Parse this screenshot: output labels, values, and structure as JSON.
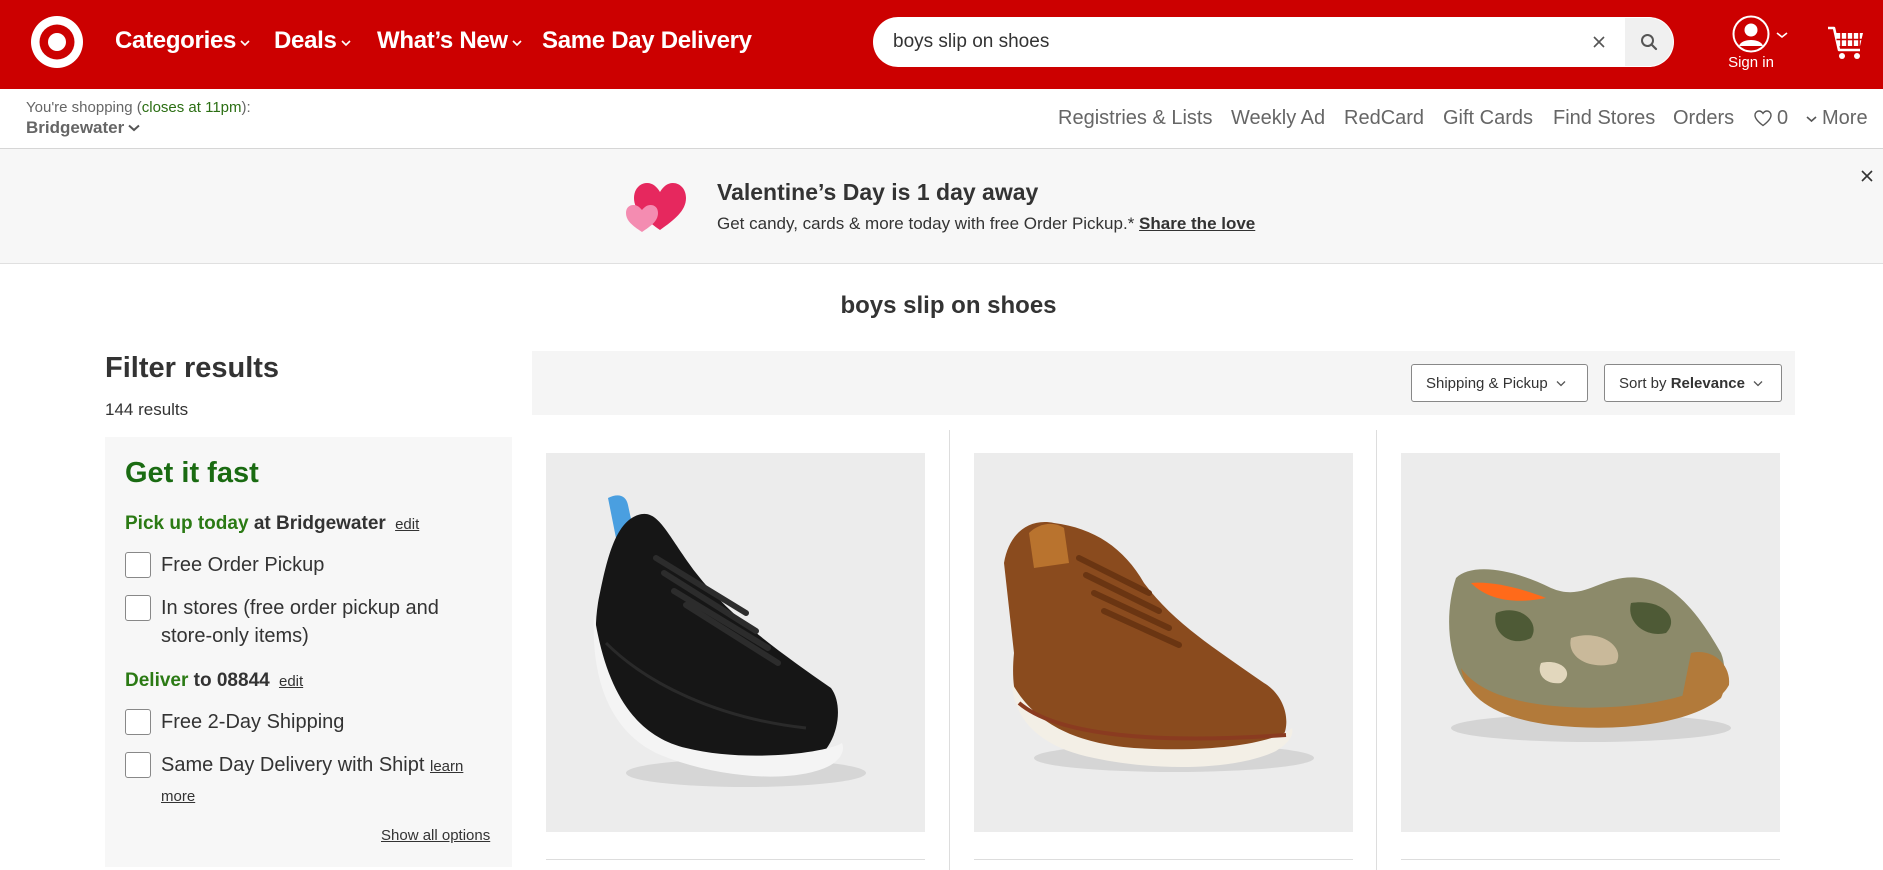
{
  "header": {
    "nav": [
      {
        "label": "Categories",
        "has_menu": true
      },
      {
        "label": "Deals",
        "has_menu": true
      },
      {
        "label": "What’s New",
        "has_menu": true
      },
      {
        "label": "Same Day Delivery",
        "has_menu": false
      }
    ],
    "search": {
      "value": "boys slip on shoes"
    },
    "account_label": "Sign in",
    "colors": {
      "brand_red": "#cc0000",
      "pickup_green": "#2b7a14"
    }
  },
  "store": {
    "line1_prefix": "You're shopping (",
    "closes": "closes at 11pm",
    "line1_suffix": "):",
    "name": "Bridgewater"
  },
  "utility_links": {
    "registries": "Registries & Lists",
    "weekly_ad": "Weekly Ad",
    "redcard": "RedCard",
    "gift_cards": "Gift Cards",
    "find_stores": "Find Stores",
    "orders": "Orders",
    "favorites_count": "0",
    "more": "More"
  },
  "banner": {
    "title": "Valentine’s Day is 1 day away",
    "subtitle": "Get candy, cards & more today with free Order Pickup.*",
    "cta": "Share the love"
  },
  "search_title": "boys slip on shoes",
  "filters": {
    "heading": "Filter results",
    "results": "144 results",
    "get_it_fast": "Get it fast",
    "pickup_head_green": "Pick up today",
    "pickup_head_rest": "at Bridgewater",
    "edit": "edit",
    "free_order_pickup": "Free Order Pickup",
    "in_stores": "In stores (free order pickup and store-only items)",
    "deliver_head_green": "Deliver",
    "deliver_head_rest": "to 08844",
    "free_2_day": "Free 2-Day Shipping",
    "same_day": "Same Day Delivery with Shipt",
    "learn_more": "learn more",
    "show_all": "Show all options"
  },
  "sort": {
    "shipping_label": "Shipping & Pickup",
    "sort_prefix": "Sort by",
    "sort_value": "Relevance"
  },
  "products": [
    {
      "image": "black-mesh-sneaker"
    },
    {
      "image": "brown-high-top-sneaker"
    },
    {
      "image": "camo-slip-on-shoe"
    }
  ]
}
